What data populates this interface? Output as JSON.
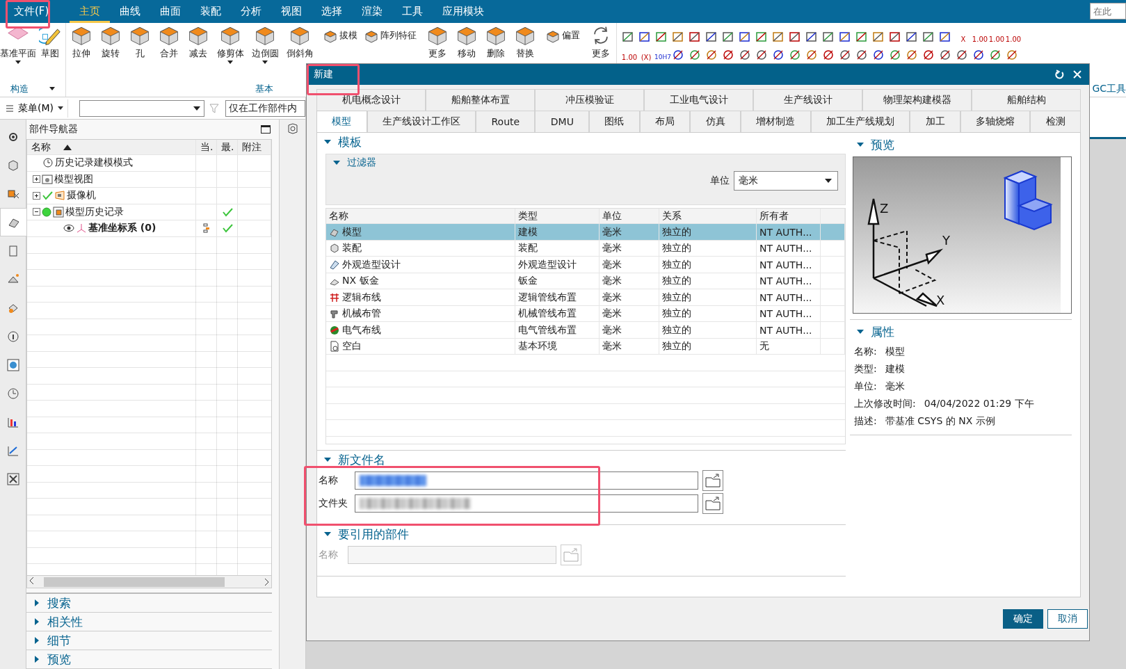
{
  "menu_bar": {
    "items": [
      {
        "label": "文件(F)",
        "selected": false,
        "highlighted": true
      },
      {
        "label": "主页",
        "selected": true,
        "highlighted": false
      },
      {
        "label": "曲线",
        "selected": false,
        "highlighted": false
      },
      {
        "label": "曲面",
        "selected": false,
        "highlighted": false
      },
      {
        "label": "装配",
        "selected": false,
        "highlighted": false
      },
      {
        "label": "分析",
        "selected": false,
        "highlighted": false
      },
      {
        "label": "视图",
        "selected": false,
        "highlighted": false
      },
      {
        "label": "选择",
        "selected": false,
        "highlighted": false
      },
      {
        "label": "渲染",
        "selected": false,
        "highlighted": false
      },
      {
        "label": "工具",
        "selected": false,
        "highlighted": false
      },
      {
        "label": "应用模块",
        "selected": false,
        "highlighted": false
      }
    ],
    "search": {
      "placeholder": "在此"
    }
  },
  "ribbon": {
    "groups": [
      {
        "label": "构造",
        "menu": true,
        "buttons": [
          {
            "kind": "plane",
            "label": "基准平面",
            "dropdown": true
          },
          {
            "kind": "sketch",
            "label": "草图",
            "dropdown": false
          }
        ]
      },
      {
        "label": "基本",
        "menu": false,
        "buttons": [
          {
            "kind": "solid",
            "label": "拉伸",
            "dropdown": false
          },
          {
            "kind": "solid",
            "label": "旋转",
            "dropdown": false
          },
          {
            "kind": "solid",
            "label": "孔",
            "dropdown": false
          },
          {
            "kind": "solid",
            "label": "合并",
            "dropdown": false
          },
          {
            "kind": "solid",
            "label": "减去",
            "dropdown": false
          },
          {
            "kind": "solid",
            "label": "修剪体",
            "dropdown": true
          },
          {
            "kind": "solid",
            "label": "边倒圆",
            "dropdown": true
          },
          {
            "kind": "solid",
            "label": "倒斜角",
            "dropdown": false
          },
          {
            "kind": "small",
            "label": "拔模",
            "dropdown": false
          },
          {
            "kind": "small",
            "label": "阵列特征",
            "dropdown": false
          },
          {
            "kind": "solid",
            "label": "更多",
            "dropdown": false
          },
          {
            "kind": "solid",
            "label": "移动",
            "dropdown": false
          },
          {
            "kind": "solid",
            "label": "删除",
            "dropdown": false
          },
          {
            "kind": "solid",
            "label": "替换",
            "dropdown": false
          },
          {
            "kind": "small",
            "label": "偏置",
            "dropdown": false
          },
          {
            "kind": "sync",
            "label": "更多",
            "dropdown": false
          }
        ]
      },
      {
        "label": "GC工具"
      }
    ],
    "tool_texts": [
      "X",
      "1.00",
      "1.00",
      "1.00",
      "1.00",
      "(X)",
      "10H7"
    ]
  },
  "toolbar": {
    "menu": "菜单(M)",
    "filter": "仅在工作部件内"
  },
  "side_tabs": [
    {
      "selected": false
    },
    {
      "selected": false
    },
    {
      "selected": false
    },
    {
      "selected": true
    },
    {
      "selected": false
    },
    {
      "selected": false
    },
    {
      "selected": false
    },
    {
      "selected": false
    },
    {
      "selected": false
    },
    {
      "selected": false
    },
    {
      "selected": false
    },
    {
      "selected": false
    },
    {
      "selected": false
    }
  ],
  "part_navigator": {
    "title": "部件导航器",
    "columns": [
      "名称",
      "当.",
      "最.",
      "附注"
    ],
    "tree": [
      {
        "kind": "clock",
        "label": "历史记录建模模式",
        "active": false,
        "checked": false,
        "current": false,
        "latest": false
      },
      {
        "kind": "view",
        "label": "模型视图",
        "expanded": false,
        "active": false,
        "checked": false,
        "current": false,
        "latest": false
      },
      {
        "kind": "camera",
        "label": "摄像机",
        "expanded": false,
        "active": false,
        "checked": true,
        "current": false,
        "latest": false
      },
      {
        "kind": "history",
        "label": "模型历史记录",
        "expanded": true,
        "active": false,
        "checked": false,
        "current": false,
        "latest": true,
        "children": [
          {
            "kind": "csys",
            "label": "基准坐标系 (0)",
            "active": true,
            "checked": false,
            "current": true,
            "latest": true
          }
        ]
      }
    ],
    "sections": [
      {
        "label": "搜索",
        "expanded": false
      },
      {
        "label": "相关性",
        "expanded": false
      },
      {
        "label": "细节",
        "expanded": false
      },
      {
        "label": "预览",
        "expanded": false
      }
    ]
  },
  "dialog": {
    "title": "新建",
    "highlighted": true,
    "tab_rows": [
      [
        {
          "label": "机电概念设计",
          "selected": false
        },
        {
          "label": "船舶整体布置",
          "selected": false
        },
        {
          "label": "冲压模验证",
          "selected": false
        },
        {
          "label": "工业电气设计",
          "selected": false
        },
        {
          "label": "生产线设计",
          "selected": false
        },
        {
          "label": "物理架构建模器",
          "selected": false
        },
        {
          "label": "船舶结构",
          "selected": false
        }
      ],
      [
        {
          "label": "模型",
          "selected": true
        },
        {
          "label": "生产线设计工作区",
          "selected": false
        },
        {
          "label": "Route",
          "selected": false
        },
        {
          "label": "DMU",
          "selected": false
        },
        {
          "label": "图纸",
          "selected": false
        },
        {
          "label": "布局",
          "selected": false
        },
        {
          "label": "仿真",
          "selected": false
        },
        {
          "label": "增材制造",
          "selected": false
        },
        {
          "label": "加工生产线规划",
          "selected": false
        },
        {
          "label": "加工",
          "selected": false
        },
        {
          "label": "多轴烧熔",
          "selected": false
        },
        {
          "label": "检测",
          "selected": false
        }
      ]
    ],
    "templates": {
      "title": "模板",
      "expanded": true,
      "filter": {
        "title": "过滤器",
        "expanded": true,
        "unit_label": "单位",
        "unit_value": "毫米"
      },
      "columns": [
        "名称",
        "类型",
        "单位",
        "关系",
        "所有者"
      ],
      "rows": [
        {
          "kind": "model",
          "name": "模型",
          "type": "建模",
          "unit": "毫米",
          "relation": "独立的",
          "owner": "NT AUTH...",
          "selected": true
        },
        {
          "kind": "assembly",
          "name": "装配",
          "type": "装配",
          "unit": "毫米",
          "relation": "独立的",
          "owner": "NT AUTH...",
          "selected": false
        },
        {
          "kind": "shape",
          "name": "外观造型设计",
          "type": "外观造型设计",
          "unit": "毫米",
          "relation": "独立的",
          "owner": "NT AUTH...",
          "selected": false
        },
        {
          "kind": "sheet",
          "name": "NX 钣金",
          "type": "钣金",
          "unit": "毫米",
          "relation": "独立的",
          "owner": "NT AUTH...",
          "selected": false
        },
        {
          "kind": "logic",
          "name": "逻辑布线",
          "type": "逻辑管线布置",
          "unit": "毫米",
          "relation": "独立的",
          "owner": "NT AUTH...",
          "selected": false
        },
        {
          "kind": "pipe",
          "name": "机械布管",
          "type": "机械管线布置",
          "unit": "毫米",
          "relation": "独立的",
          "owner": "NT AUTH...",
          "selected": false
        },
        {
          "kind": "wire",
          "name": "电气布线",
          "type": "电气管线布置",
          "unit": "毫米",
          "relation": "独立的",
          "owner": "NT AUTH...",
          "selected": false
        },
        {
          "kind": "blank",
          "name": "空白",
          "type": "基本环境",
          "unit": "毫米",
          "relation": "独立的",
          "owner": "无",
          "selected": false
        }
      ]
    },
    "new_file": {
      "title": "新文件名",
      "expanded": true,
      "highlighted": true,
      "fields": [
        {
          "label": "名称",
          "redacted": true,
          "selected_text": true
        },
        {
          "label": "文件夹",
          "redacted": true,
          "selected_text": false
        }
      ]
    },
    "referenced_part": {
      "title": "要引用的部件",
      "expanded": true,
      "field": {
        "label": "名称",
        "disabled": true
      }
    },
    "preview": {
      "title": "预览",
      "expanded": true,
      "axis_labels": [
        "Z",
        "Y",
        "X"
      ]
    },
    "properties": {
      "title": "属性",
      "expanded": true,
      "items": [
        {
          "label": "名称:",
          "value": "模型"
        },
        {
          "label": "类型:",
          "value": "建模"
        },
        {
          "label": "单位:",
          "value": "毫米"
        },
        {
          "label": "上次修改时间:",
          "value": "04/04/2022 01:29 下午"
        },
        {
          "label": "描述:",
          "value": "带基准 CSYS 的 NX 示例"
        }
      ]
    },
    "buttons": [
      {
        "label": "确定",
        "primary": true
      },
      {
        "label": "取消",
        "primary": false
      }
    ]
  }
}
